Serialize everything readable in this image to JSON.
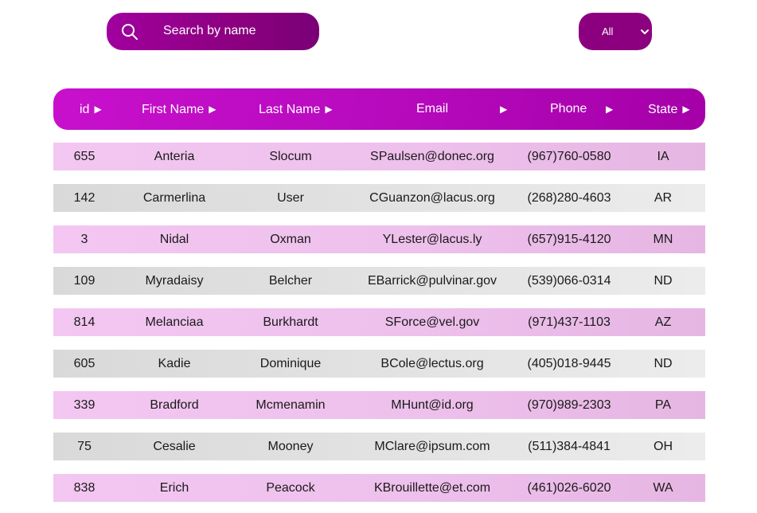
{
  "search": {
    "placeholder": "Search by name",
    "value": ""
  },
  "filter": {
    "selected": "All"
  },
  "table": {
    "headers": [
      {
        "key": "id",
        "label": "id",
        "arrow": "▶"
      },
      {
        "key": "first_name",
        "label": "First Name",
        "arrow": "▶"
      },
      {
        "key": "last_name",
        "label": "Last Name",
        "arrow": "▶"
      },
      {
        "key": "email",
        "label": "Email",
        "arrow": "▶"
      },
      {
        "key": "phone",
        "label": "Phone",
        "arrow": "▶"
      },
      {
        "key": "state",
        "label": "State",
        "arrow": "▶"
      }
    ],
    "rows": [
      {
        "id": "655",
        "first_name": "Anteria",
        "last_name": "Slocum",
        "email": "SPaulsen@donec.org",
        "phone": "(967)760-0580",
        "state": "IA"
      },
      {
        "id": "142",
        "first_name": "Carmerlina",
        "last_name": "User",
        "email": "CGuanzon@lacus.org",
        "phone": "(268)280-4603",
        "state": "AR"
      },
      {
        "id": "3",
        "first_name": "Nidal",
        "last_name": "Oxman",
        "email": "YLester@lacus.ly",
        "phone": "(657)915-4120",
        "state": "MN"
      },
      {
        "id": "109",
        "first_name": "Myradaisy",
        "last_name": "Belcher",
        "email": "EBarrick@pulvinar.gov",
        "phone": "(539)066-0314",
        "state": "ND"
      },
      {
        "id": "814",
        "first_name": "Melanciaa",
        "last_name": "Burkhardt",
        "email": "SForce@vel.gov",
        "phone": "(971)437-1103",
        "state": "AZ"
      },
      {
        "id": "605",
        "first_name": "Kadie",
        "last_name": "Dominique",
        "email": "BCole@lectus.org",
        "phone": "(405)018-9445",
        "state": "ND"
      },
      {
        "id": "339",
        "first_name": "Bradford",
        "last_name": "Mcmenamin",
        "email": "MHunt@id.org",
        "phone": "(970)989-2303",
        "state": "PA"
      },
      {
        "id": "75",
        "first_name": "Cesalie",
        "last_name": "Mooney",
        "email": "MClare@ipsum.com",
        "phone": "(511)384-4841",
        "state": "OH"
      },
      {
        "id": "838",
        "first_name": "Erich",
        "last_name": "Peacock",
        "email": "KBrouillette@et.com",
        "phone": "(461)026-6020",
        "state": "WA"
      }
    ]
  },
  "colors": {
    "accent": "#8c0080",
    "header": "#b90bc0",
    "row_pink": "#eec0ec",
    "row_grey": "#e3e3e3"
  },
  "icons": {
    "search": "search-icon",
    "select": "chevron-down-icon",
    "sort": "sort-arrow-icon"
  }
}
